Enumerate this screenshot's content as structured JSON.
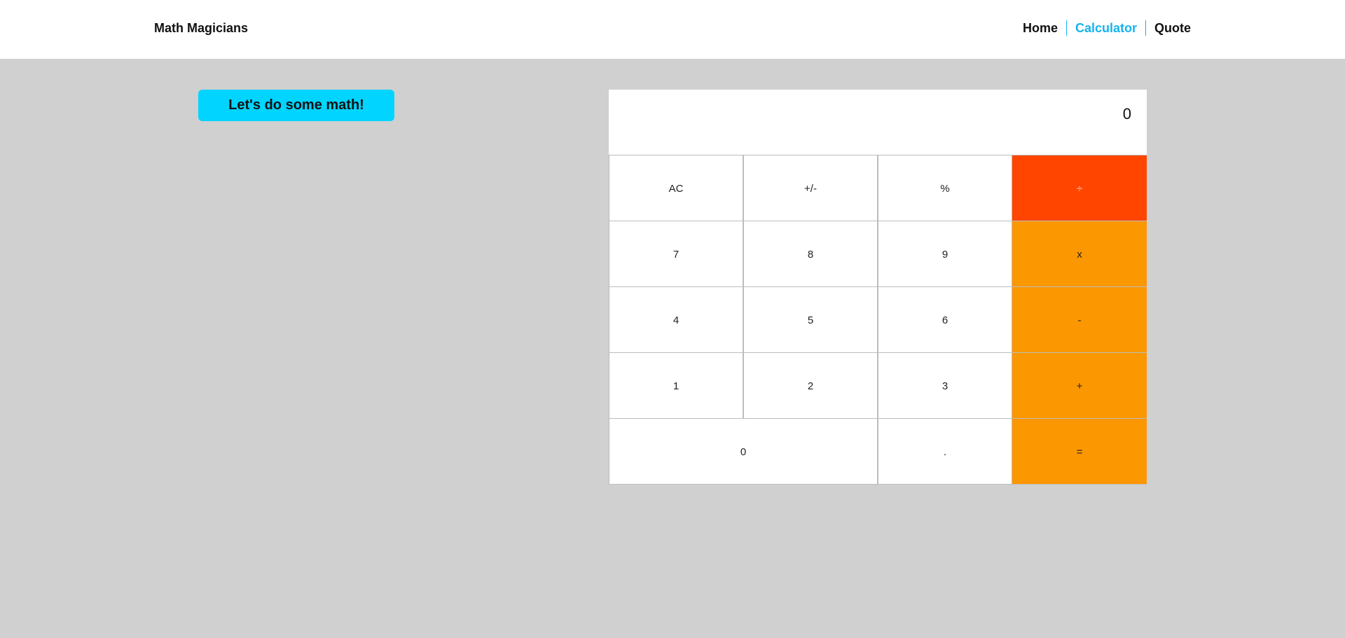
{
  "header": {
    "brand": "Math Magicians",
    "nav": [
      {
        "label": "Home",
        "active": false
      },
      {
        "label": "Calculator",
        "active": true
      },
      {
        "label": "Quote",
        "active": false
      }
    ]
  },
  "hero": {
    "button_label": "Let's do some math!"
  },
  "calculator": {
    "display_value": "0",
    "keys": [
      {
        "label": "AC"
      },
      {
        "label": "+/-"
      },
      {
        "label": "%"
      },
      {
        "label": "÷"
      },
      {
        "label": "7"
      },
      {
        "label": "8"
      },
      {
        "label": "9"
      },
      {
        "label": "x"
      },
      {
        "label": "4"
      },
      {
        "label": "5"
      },
      {
        "label": "6"
      },
      {
        "label": "-"
      },
      {
        "label": "1"
      },
      {
        "label": "2"
      },
      {
        "label": "3"
      },
      {
        "label": "+"
      },
      {
        "label": "0"
      },
      {
        "label": "."
      },
      {
        "label": "="
      }
    ]
  },
  "colors": {
    "accent": "#15b3ee",
    "hero_button": "#00d4ff",
    "operator": "#fb9700",
    "divide_operator": "#ff4500",
    "background": "#d0d0d0"
  }
}
